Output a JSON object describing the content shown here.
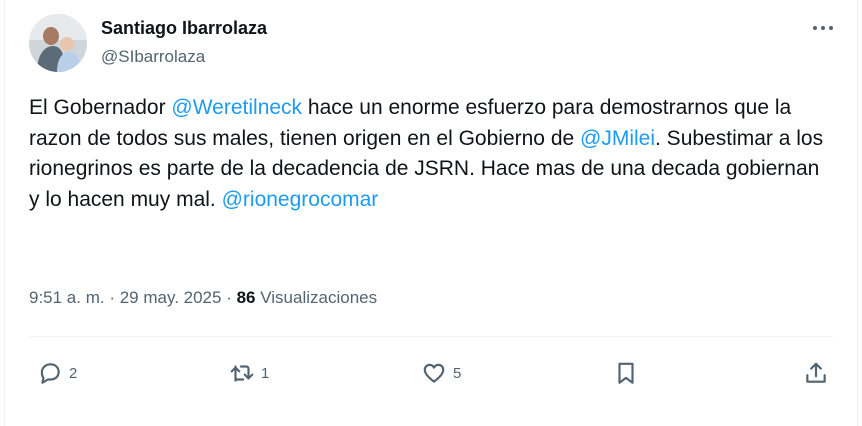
{
  "author": {
    "name": "Santiago Ibarrolaza",
    "handle": "@SIbarrolaza"
  },
  "tweet": {
    "text_1": "El Gobernador ",
    "mention_1": "@Weretilneck",
    "text_2": " hace un enorme esfuerzo para demostrarnos que la razon de todos sus males, tienen origen en el Gobierno de ",
    "mention_2": "@JMilei",
    "text_3": ". Subestimar a los rionegrinos es parte de la decadencia de JSRN. Hace mas de una decada gobiernan y lo hacen muy mal. ",
    "mention_3": "@rionegrocomar"
  },
  "meta": {
    "time": "9:51 a. m.",
    "separator": " · ",
    "date": "29 may. 2025",
    "views_count": "86",
    "views_label": "Visualizaciones"
  },
  "actions": {
    "reply_count": "2",
    "retweet_count": "1",
    "like_count": "5"
  },
  "icons": {
    "more": "more-icon",
    "reply": "reply-icon",
    "retweet": "retweet-icon",
    "like": "heart-icon",
    "bookmark": "bookmark-icon",
    "share": "share-icon"
  },
  "colors": {
    "text": "#0f1419",
    "muted": "#536471",
    "link": "#1d9bf0",
    "divider": "#eff3f4"
  }
}
